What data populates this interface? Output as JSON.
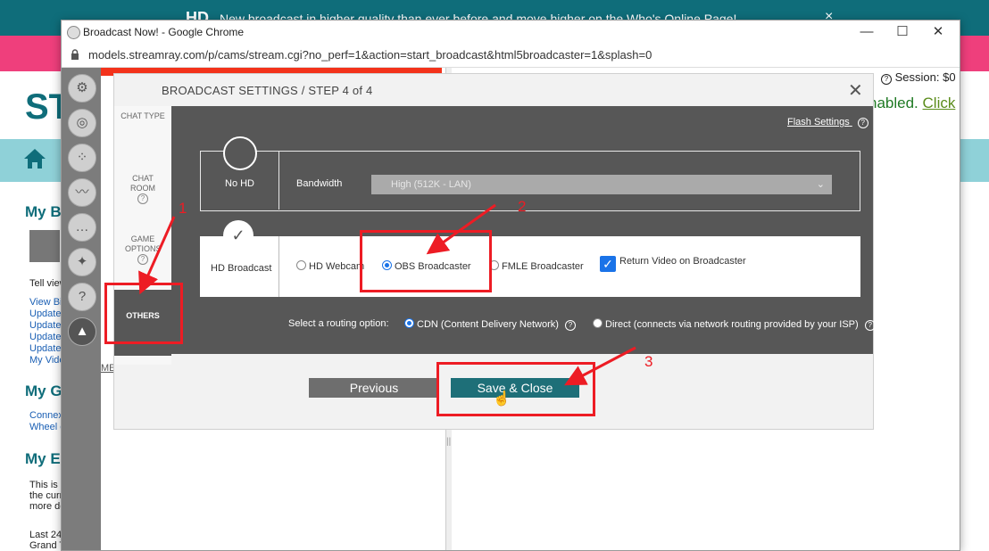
{
  "background_page": {
    "banner_logo": "HD",
    "banner_text": "New broadcast in higher quality than ever before and move higher on the Who's Online Page!",
    "banner_close": "×",
    "logo_text": "ST",
    "sections": [
      "My Bi",
      "My Ga",
      "My Ea"
    ],
    "tell_text": "Tell view",
    "links1": [
      "View Bi",
      "Update",
      "Update",
      "Update",
      "Update",
      "My Vide"
    ],
    "links2": [
      "Connex",
      "Wheel c"
    ],
    "earn_text": [
      "This is a",
      "the curr",
      "more de"
    ],
    "last_text": [
      "Last 24",
      "Grand T"
    ],
    "me_text": "ME"
  },
  "browser": {
    "window_title": "Broadcast Now! - Google Chrome",
    "url": "models.streamray.com/p/cams/stream.cgi?no_perf=1&action=start_broadcast&html5broadcaster=1&splash=0",
    "minimize": "—",
    "maximize": "☐",
    "close": "✕"
  },
  "page": {
    "session": "Session: $0",
    "enabled_text": "nabled.",
    "click_link": "Click"
  },
  "dialog": {
    "title": "BROADCAST SETTINGS / STEP 4 of 4",
    "close": "✕",
    "steps": [
      "CHAT TYPE",
      "CHAT ROOM",
      "GAME OPTIONS",
      "OTHERS"
    ],
    "flash_settings": "Flash Settings",
    "nohd_label": "No HD",
    "bandwidth_label": "Bandwidth",
    "bandwidth_value": "High (512K - LAN)",
    "hd_label": "HD Broadcast",
    "checkmark": "✓",
    "broadcaster_options": [
      {
        "label": "HD Webcam",
        "selected": false
      },
      {
        "label": "OBS Broadcaster",
        "selected": true
      },
      {
        "label": "FMLE Broadcaster",
        "selected": false
      }
    ],
    "return_video_label": "Return Video on Broadcaster",
    "return_video_checked": true,
    "routing_label": "Select a routing option:",
    "routing_options": [
      {
        "label": "CDN (Content Delivery Network)",
        "selected": true
      },
      {
        "label": "Direct (connects via network routing provided by your ISP)",
        "selected": false
      }
    ],
    "previous_label": "Previous",
    "save_label": "Save & Close"
  },
  "annotations": {
    "n1": "1",
    "n2": "2",
    "n3": "3"
  },
  "colors": {
    "teal": "#0f6d7a",
    "pink": "#ef3f7c",
    "save_btn": "#1e6f78",
    "prev_btn": "#6e6e6e",
    "annotation_red": "#ed1c24"
  }
}
